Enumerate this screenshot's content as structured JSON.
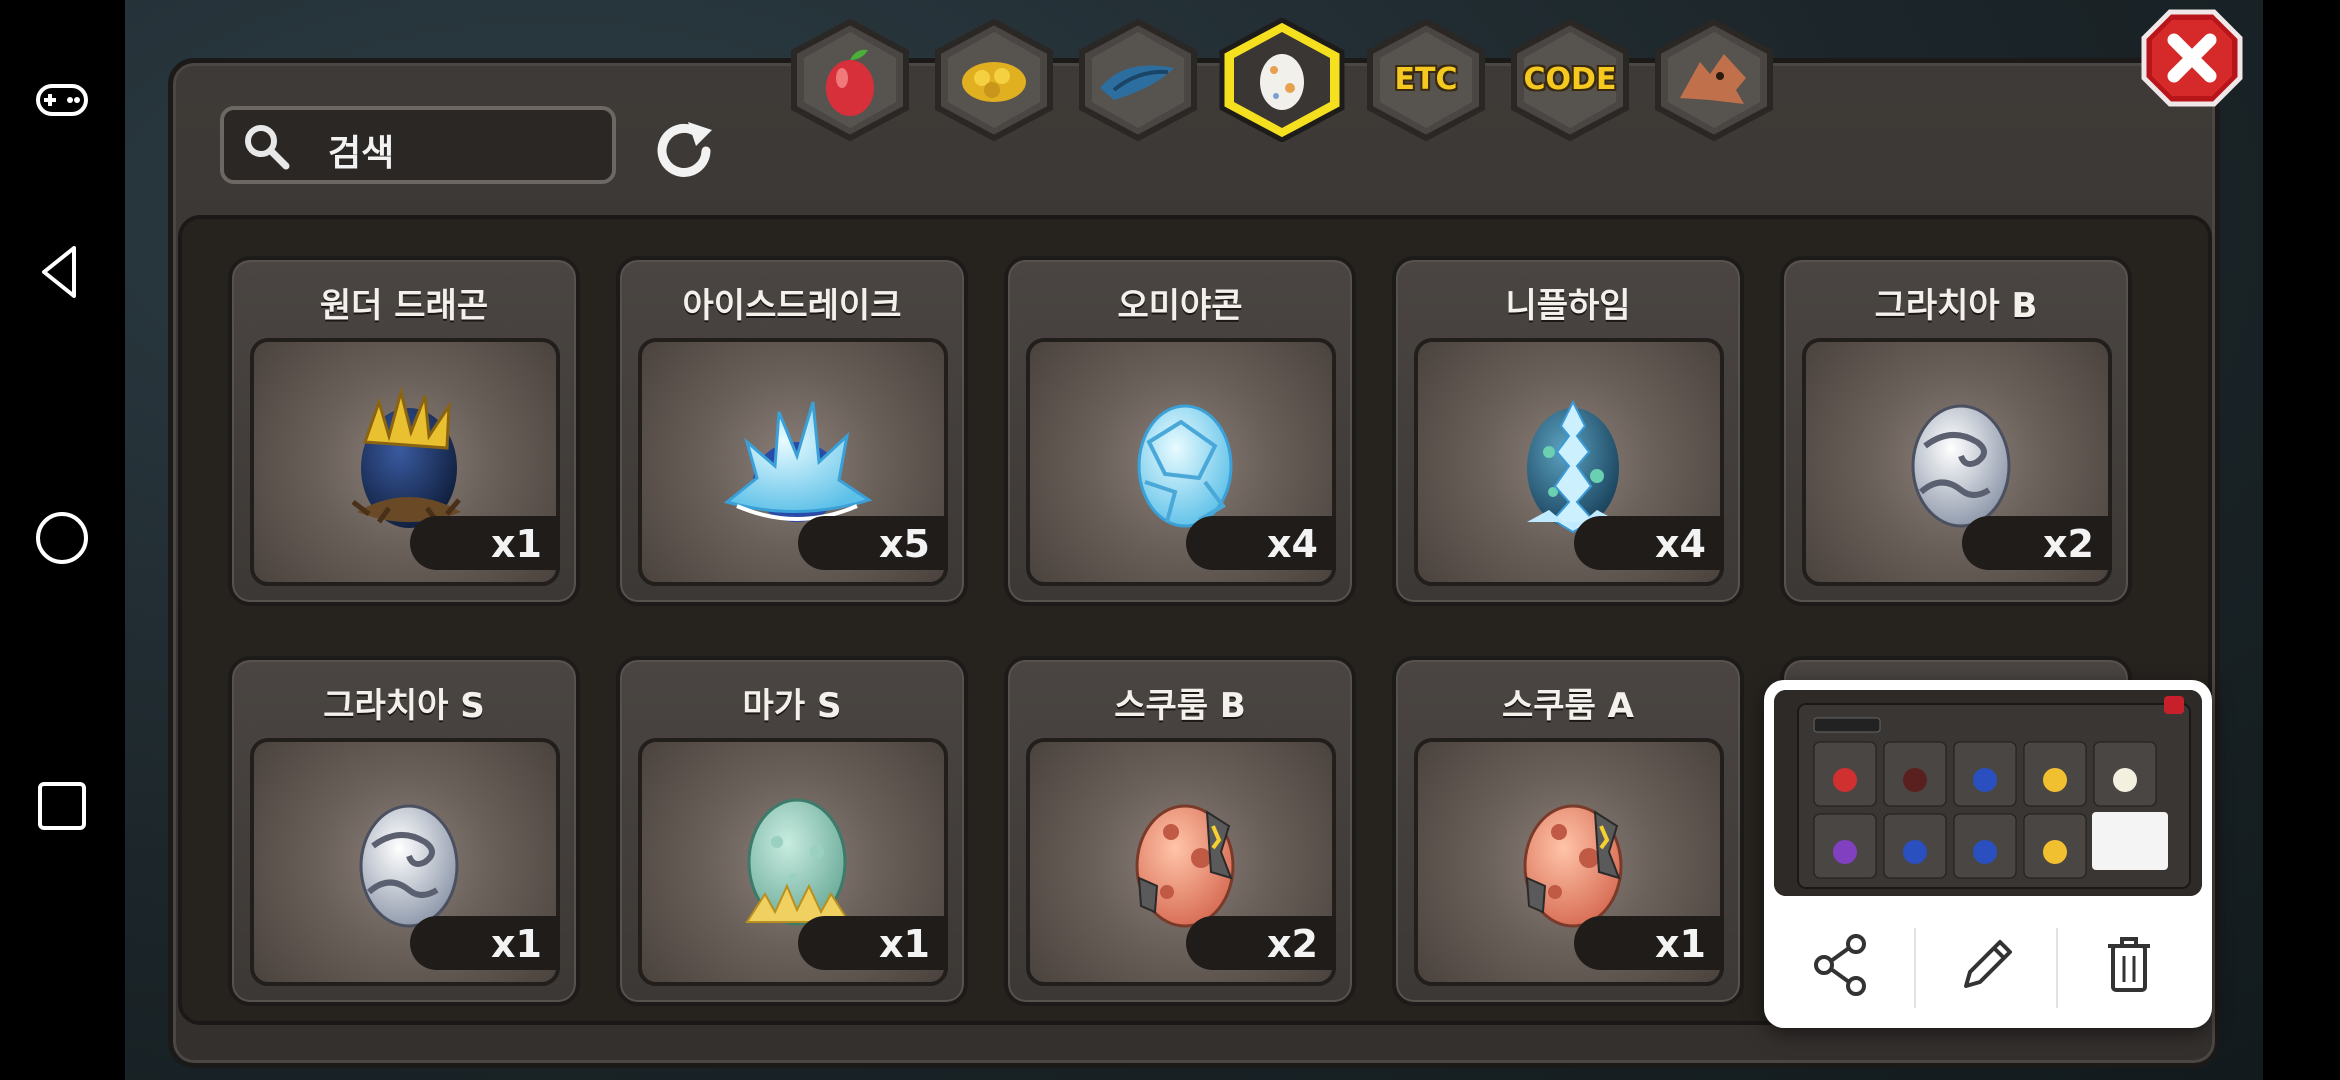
{
  "search": {
    "placeholder": "검색"
  },
  "tabs": [
    {
      "name": "fruit",
      "label": "",
      "selected": false
    },
    {
      "name": "gold",
      "label": "",
      "selected": false
    },
    {
      "name": "dragon-tail",
      "label": "",
      "selected": false
    },
    {
      "name": "egg",
      "label": "",
      "selected": true
    },
    {
      "name": "etc",
      "label": "ETC",
      "selected": false
    },
    {
      "name": "code",
      "label": "CODE",
      "selected": false
    },
    {
      "name": "dragon-head",
      "label": "",
      "selected": false
    }
  ],
  "cards": [
    {
      "name": "원더 드래곤",
      "qty": "x1",
      "egg": "wonder-dragon-egg"
    },
    {
      "name": "아이스드레이크",
      "qty": "x5",
      "egg": "ice-drake-egg"
    },
    {
      "name": "오미야콘",
      "qty": "x4",
      "egg": "omiyakon-egg"
    },
    {
      "name": "니플하임",
      "qty": "x4",
      "egg": "niflheim-egg"
    },
    {
      "name": "그라치아 B",
      "qty": "x2",
      "egg": "grazia-b-egg"
    },
    {
      "name": "그라치아 S",
      "qty": "x1",
      "egg": "grazia-s-egg"
    },
    {
      "name": "마가 S",
      "qty": "x1",
      "egg": "maga-s-egg"
    },
    {
      "name": "스쿠룸 B",
      "qty": "x2",
      "egg": "scurum-b-egg"
    },
    {
      "name": "스쿠룸 A",
      "qty": "x1",
      "egg": "scurum-a-egg"
    }
  ],
  "preview": {
    "actions": [
      "share",
      "edit",
      "delete"
    ]
  }
}
